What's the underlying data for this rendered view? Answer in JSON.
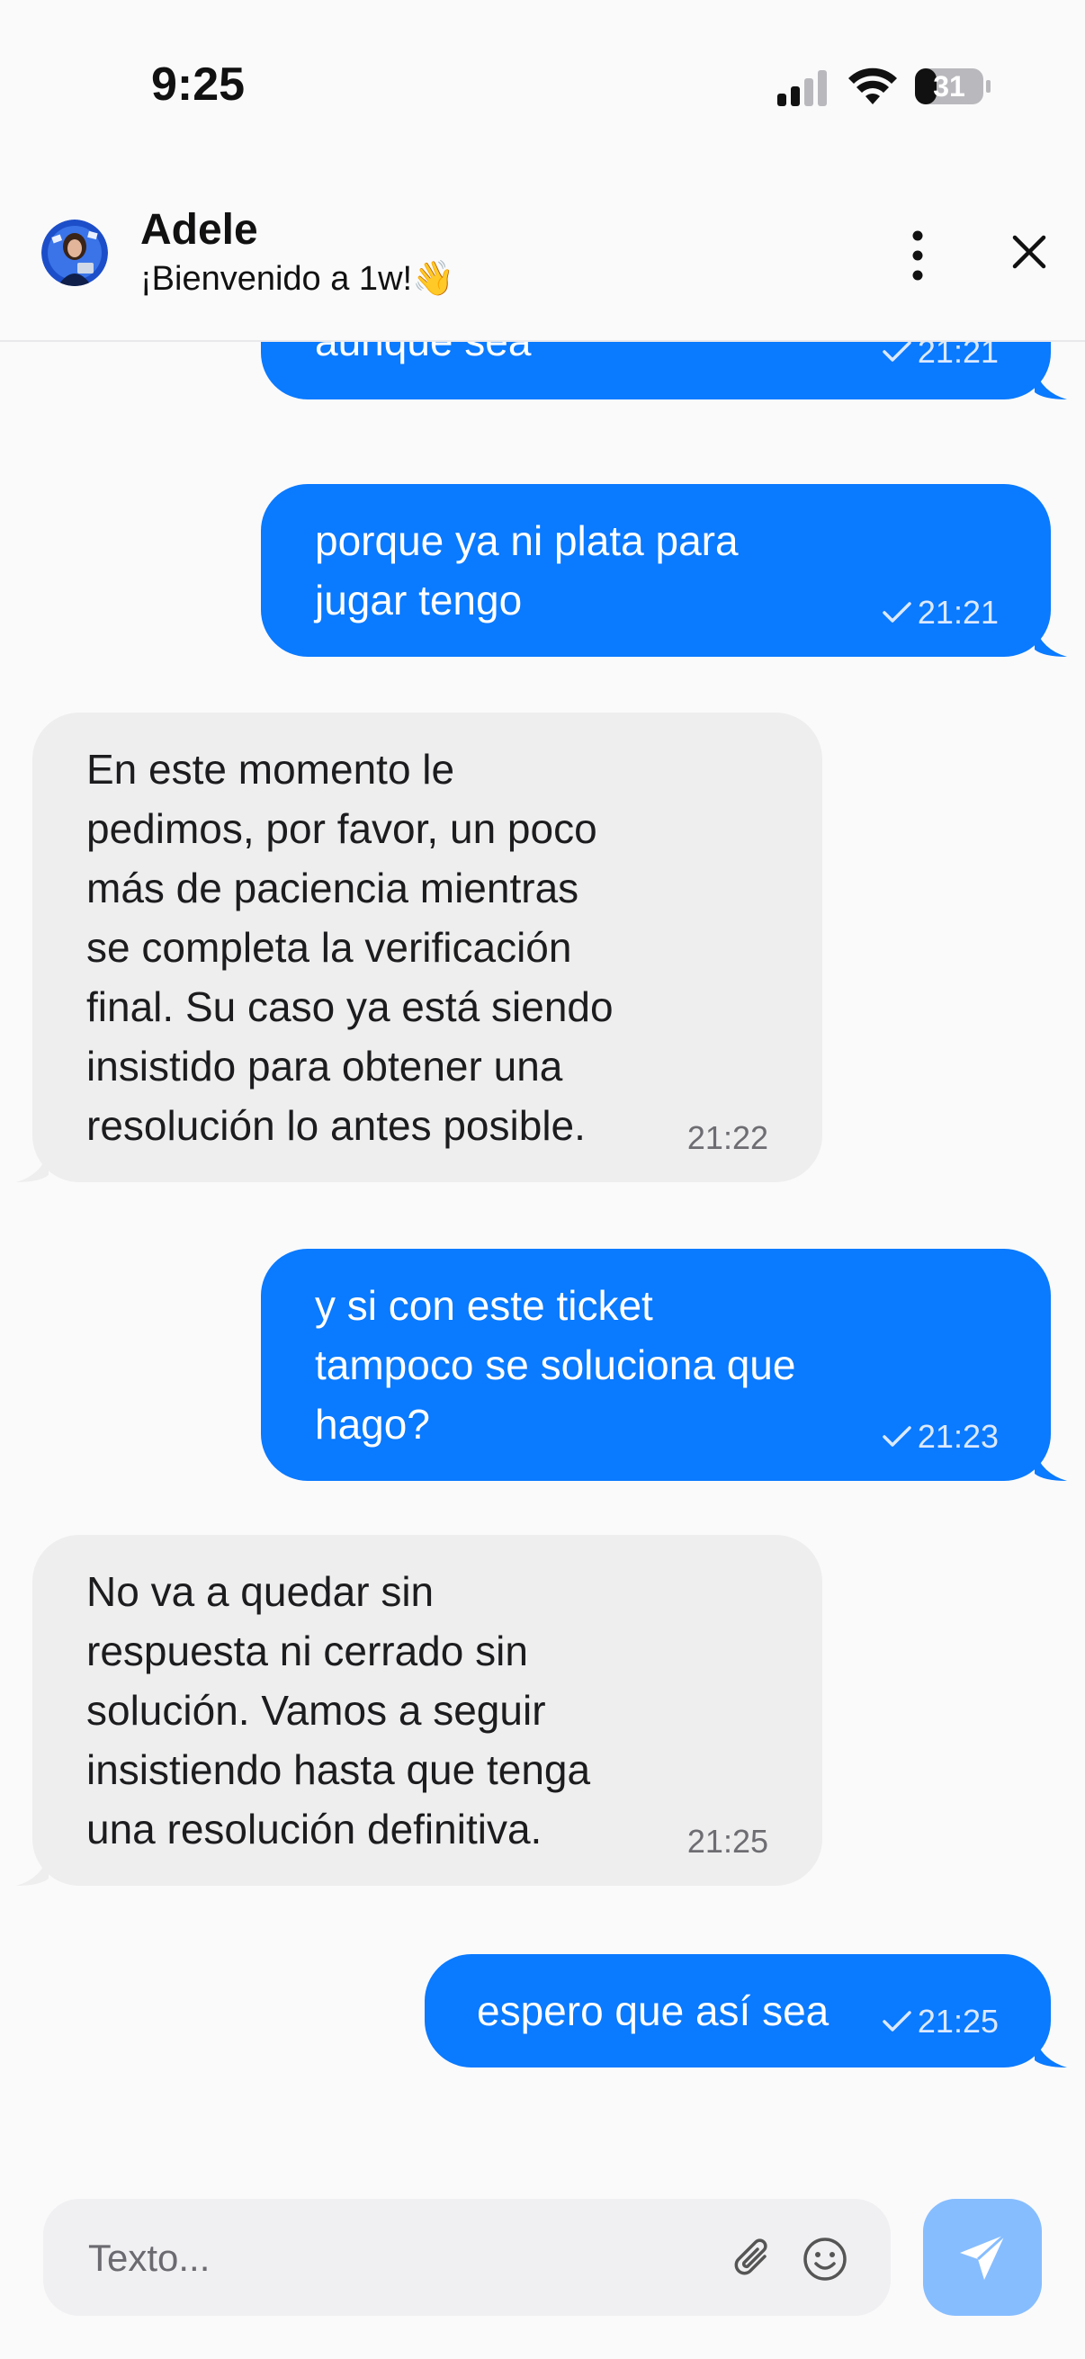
{
  "status_bar": {
    "time": "9:25",
    "battery": "31"
  },
  "header": {
    "agent_name": "Adele",
    "subtitle": "¡Bienvenido a 1w!👋"
  },
  "messages": [
    {
      "direction": "out",
      "text": "aunque sea",
      "time": "21:21"
    },
    {
      "direction": "out",
      "text": "porque ya ni plata para\njugar tengo",
      "time": "21:21"
    },
    {
      "direction": "in",
      "text": "En este momento le\npedimos, por favor, un poco\nmás de paciencia mientras\nse completa la verificación\nfinal. Su caso ya está siendo\ninsistido para obtener una\nresolución lo antes posible.",
      "time": "21:22"
    },
    {
      "direction": "out",
      "text": "y si con este ticket\ntampoco se soluciona que\nhago?",
      "time": "21:23"
    },
    {
      "direction": "in",
      "text": "No va a quedar sin\nrespuesta ni cerrado sin\nsolución. Vamos a seguir\ninsistiendo hasta que tenga\nuna resolución definitiva.",
      "time": "21:25"
    },
    {
      "direction": "out",
      "text": "espero que así sea",
      "time": "21:25"
    }
  ],
  "composer": {
    "placeholder": "Texto..."
  },
  "icons": {
    "attach": "paperclip-icon",
    "emoji": "smiley-icon",
    "send": "paper-plane-icon",
    "menu": "more-vertical-icon",
    "close": "close-icon"
  },
  "colors": {
    "outgoing_bubble": "#0a7aff",
    "incoming_bubble": "#eeeeef",
    "send_button": "#86bdff"
  }
}
